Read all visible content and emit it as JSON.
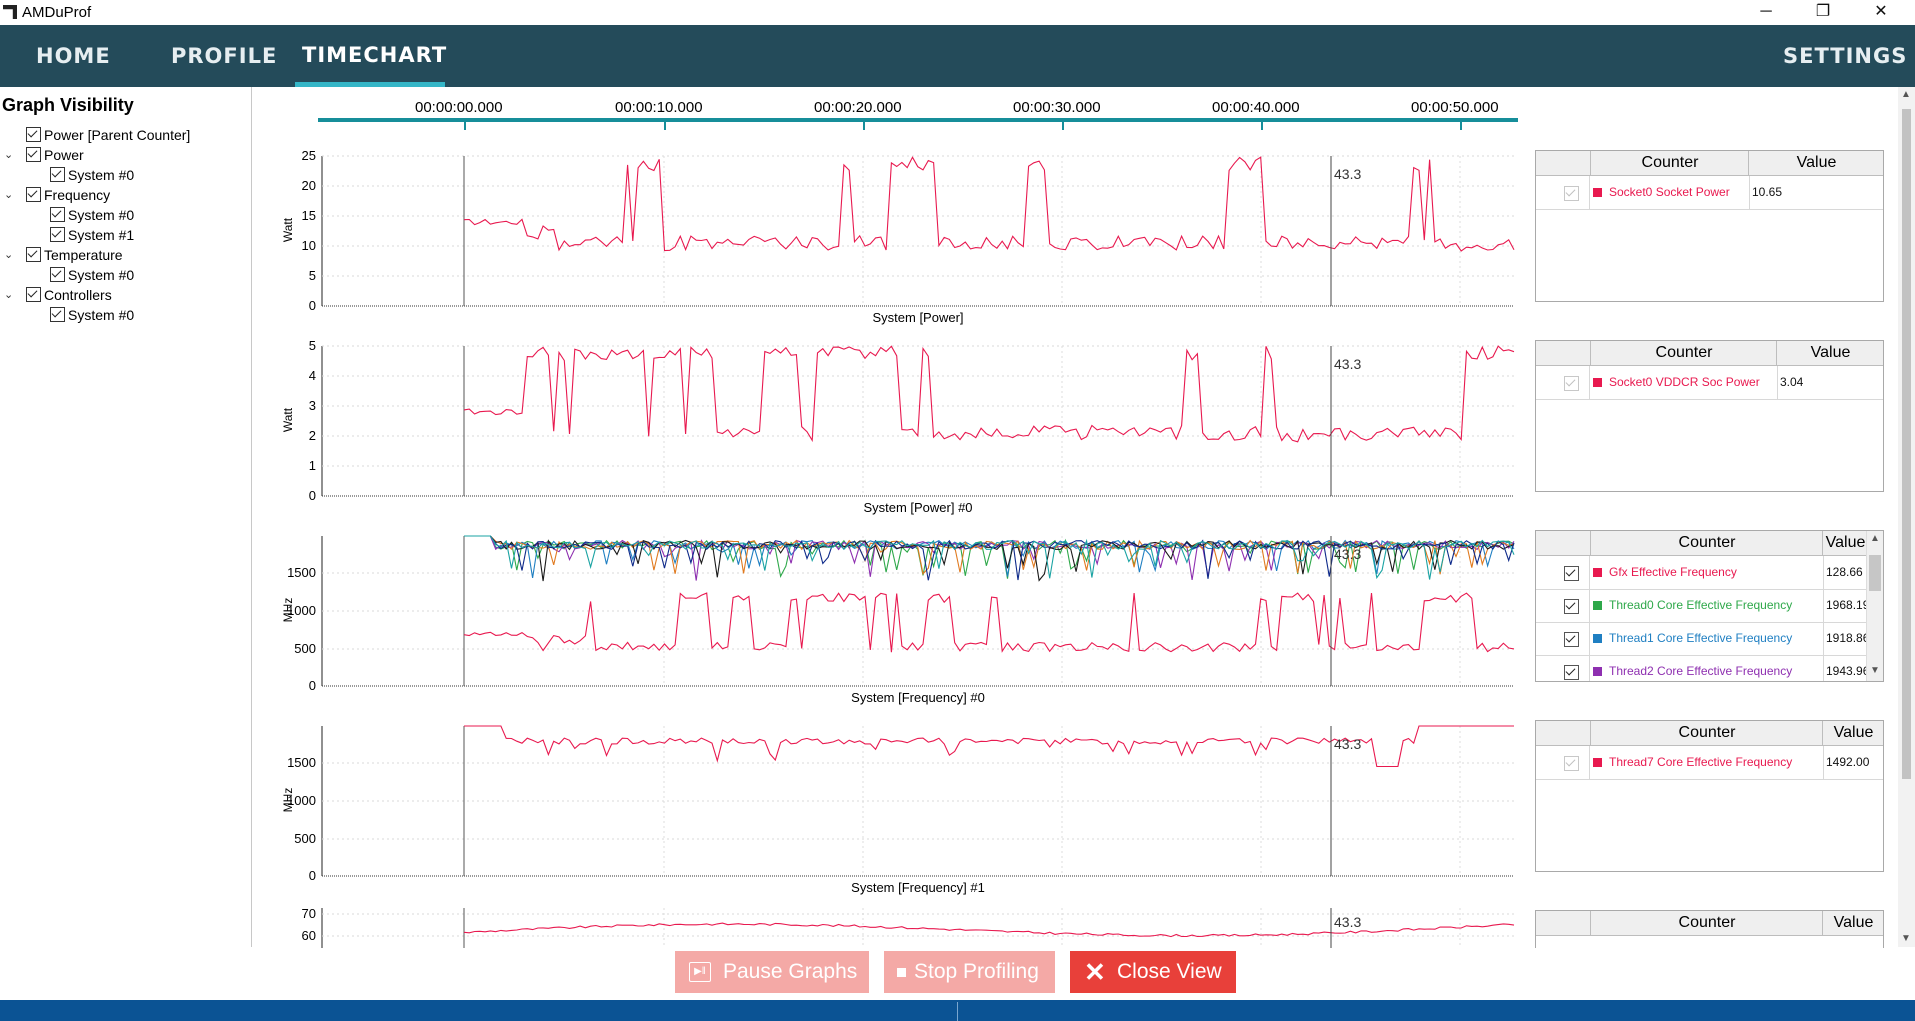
{
  "window": {
    "title": "AMDuProf",
    "minimize": "─",
    "restore": "❐",
    "close": "✕"
  },
  "nav": {
    "tabs": [
      "HOME",
      "PROFILE",
      "TIMECHART"
    ],
    "active": "TIMECHART",
    "settings": "SETTINGS"
  },
  "sidebar": {
    "heading": "Graph Visibility",
    "items": [
      {
        "label": "Power [Parent Counter]",
        "level": 0,
        "expandable": false
      },
      {
        "label": "Power",
        "level": 0,
        "expandable": true
      },
      {
        "label": "System #0",
        "level": 1,
        "expandable": false
      },
      {
        "label": "Frequency",
        "level": 0,
        "expandable": true
      },
      {
        "label": "System #0",
        "level": 1,
        "expandable": false
      },
      {
        "label": "System #1",
        "level": 1,
        "expandable": false
      },
      {
        "label": "Temperature",
        "level": 0,
        "expandable": true
      },
      {
        "label": "System #0",
        "level": 1,
        "expandable": false
      },
      {
        "label": "Controllers",
        "level": 0,
        "expandable": true
      },
      {
        "label": "System #0",
        "level": 1,
        "expandable": false
      }
    ]
  },
  "timeline": {
    "ticks": [
      "00:00:00.000",
      "00:00:10.000",
      "00:00:20.000",
      "00:00:30.000",
      "00:00:40.000",
      "00:00:50.000"
    ]
  },
  "cursor_label": "43.3",
  "graphs": [
    {
      "title": "System [Power]",
      "ylabel": "Watt",
      "yticks": [
        "25",
        "20",
        "15",
        "10",
        "5",
        "0"
      ]
    },
    {
      "title": "System [Power] #0",
      "ylabel": "Watt",
      "yticks": [
        "5",
        "4",
        "3",
        "2",
        "1",
        "0"
      ]
    },
    {
      "title": "System [Frequency] #0",
      "ylabel": "MHz",
      "yticks": [
        "1500",
        "1000",
        "500",
        "0"
      ]
    },
    {
      "title": "System [Frequency] #1",
      "ylabel": "MHz",
      "yticks": [
        "1500",
        "1000",
        "500",
        "0"
      ]
    },
    {
      "title": "",
      "ylabel": "",
      "yticks": [
        "70",
        "60"
      ]
    }
  ],
  "tables": {
    "header_counter": "Counter",
    "header_value": "Value",
    "t1": [
      {
        "name": "Socket0 Socket Power",
        "value": "10.65",
        "color": "#e8194f"
      }
    ],
    "t2": [
      {
        "name": "Socket0 VDDCR Soc Power",
        "value": "3.04",
        "color": "#e8194f"
      }
    ],
    "t3": [
      {
        "name": "Gfx Effective Frequency",
        "value": "128.66",
        "color": "#e8194f"
      },
      {
        "name": "Thread0 Core Effective Frequency",
        "value": "1968.19",
        "color": "#2ea84a"
      },
      {
        "name": "Thread1 Core Effective Frequency",
        "value": "1918.86",
        "color": "#1f7fc2"
      },
      {
        "name": "Thread2 Core Effective Frequency",
        "value": "1943.96",
        "color": "#8e2fb0"
      }
    ],
    "t4": [
      {
        "name": "Thread7 Core Effective Frequency",
        "value": "1492.00",
        "color": "#e8194f"
      }
    ]
  },
  "buttons": {
    "pause": "Pause Graphs",
    "stop": "Stop Profiling",
    "close": "Close View"
  },
  "colors": {
    "nav": "#244b5a",
    "accent": "#35b6c7",
    "series": "#e8194f",
    "close_button": "#e8403a",
    "disabled_button": "#f4a9a6",
    "status": "#0b5394"
  }
}
